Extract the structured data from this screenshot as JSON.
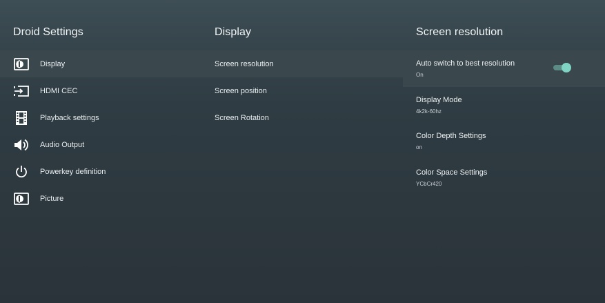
{
  "column1": {
    "title": "Droid Settings",
    "items": [
      {
        "label": "Display",
        "icon": "display-icon",
        "selected": true
      },
      {
        "label": "HDMI CEC",
        "icon": "hdmi-input-icon",
        "selected": false
      },
      {
        "label": "Playback settings",
        "icon": "film-icon",
        "selected": false
      },
      {
        "label": "Audio Output",
        "icon": "speaker-icon",
        "selected": false
      },
      {
        "label": "Powerkey definition",
        "icon": "power-icon",
        "selected": false
      },
      {
        "label": "Picture",
        "icon": "display-icon",
        "selected": false
      }
    ]
  },
  "column2": {
    "title": "Display",
    "items": [
      {
        "label": "Screen resolution",
        "selected": true
      },
      {
        "label": "Screen position",
        "selected": false
      },
      {
        "label": "Screen Rotation",
        "selected": false
      }
    ]
  },
  "column3": {
    "title": "Screen resolution",
    "items": [
      {
        "title": "Auto switch to best resolution",
        "value": "On",
        "toggle": true,
        "toggle_on": true,
        "selected": true
      },
      {
        "title": "Display Mode",
        "value": "4k2k-60hz",
        "toggle": false,
        "selected": false
      },
      {
        "title": "Color Depth Settings",
        "value": "on",
        "toggle": false,
        "selected": false
      },
      {
        "title": "Color Space Settings",
        "value": "YCbCr420",
        "toggle": false,
        "selected": false
      }
    ]
  },
  "colors": {
    "toggle_accent": "#7fd4c4",
    "selected_row": "#3a474d"
  }
}
